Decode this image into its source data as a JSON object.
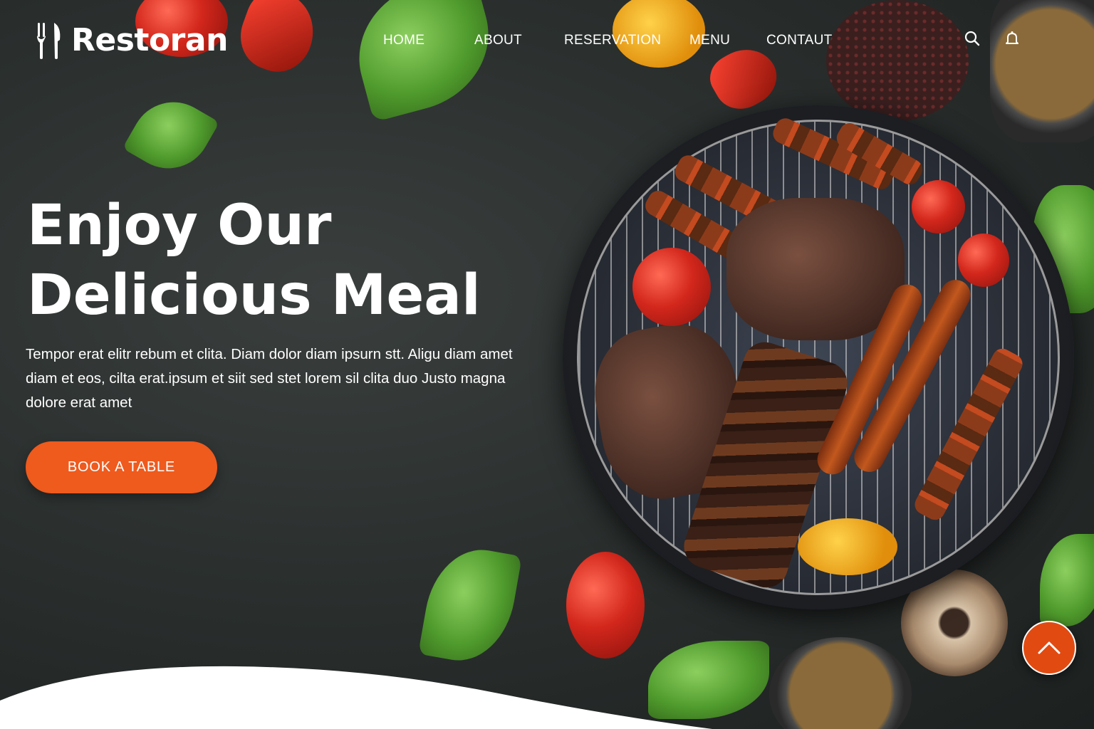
{
  "brand": {
    "name": "Restoran",
    "icon": "utensils-icon"
  },
  "nav": {
    "items": [
      {
        "label": "HOME"
      },
      {
        "label": "ABOUT"
      },
      {
        "label": "RESERVATION"
      },
      {
        "label": "MENU"
      },
      {
        "label": "CONTAUT"
      }
    ],
    "icons": [
      "search-icon",
      "bell-icon"
    ]
  },
  "hero": {
    "title_line1": "Enjoy Our",
    "title_line2": "Delicious Meal",
    "text": "Tempor erat elitr rebum et clita. Diam dolor diam ipsurn stt. Aligu diam amet diam et eos, cilta erat.ipsum et siit sed stet lorem sil clita duo Justo magna dolore erat amet",
    "button_label": "BOOK A TABLE"
  },
  "back_to_top": {
    "icon": "chevron-up-icon"
  },
  "colors": {
    "accent": "#ef5a1d",
    "background": "#2b302f",
    "text": "#ffffff"
  }
}
